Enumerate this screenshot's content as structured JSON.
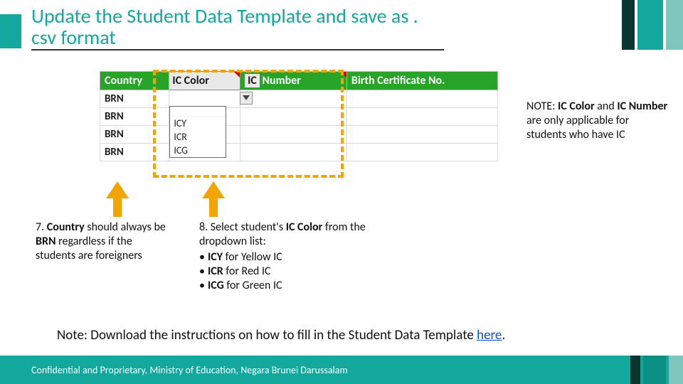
{
  "title": "Update the Student Data Template and save as . csv format",
  "table": {
    "headers": {
      "country": "Country",
      "ic_color": "IC Color",
      "ic_number": "IC Number",
      "birth_cert": "Birth Certificate No."
    },
    "rows": [
      {
        "country": "BRN"
      },
      {
        "country": "BRN"
      },
      {
        "country": "BRN"
      },
      {
        "country": "BRN"
      }
    ],
    "dropdown_options": [
      "ICY",
      "ICR",
      "ICG"
    ]
  },
  "colors": {
    "teal": "#12a89d",
    "dash_orange": "#f2a500",
    "header_green": "#28a428"
  },
  "note_right": {
    "prefix": "NOTE: ",
    "bold1": "IC Color",
    "mid": " and ",
    "bold2": "IC Number",
    "rest": " are only applicable for students who have IC"
  },
  "step7": {
    "prefix": "7. ",
    "bold1": "Country",
    "mid1": " should always be ",
    "bold2": "BRN",
    "rest": " regardless if the students are foreigners"
  },
  "step8": {
    "line1_prefix": "8. Select student's ",
    "line1_bold": "IC Color",
    "line1_rest": " from the dropdown list:",
    "bullets": [
      {
        "bold": "ICY",
        "rest": " for Yellow IC"
      },
      {
        "bold": "ICR",
        "rest": " for Red IC"
      },
      {
        "bold": "ICG",
        "rest": " for Green IC"
      }
    ]
  },
  "bottom_note": {
    "text": "Note: Download the instructions on how to fill in the Student Data Template ",
    "link_text": "here",
    "period": "."
  },
  "footer_text": "Confidential and Proprietary, Ministry of Education, Negara Brunei Darussalam"
}
